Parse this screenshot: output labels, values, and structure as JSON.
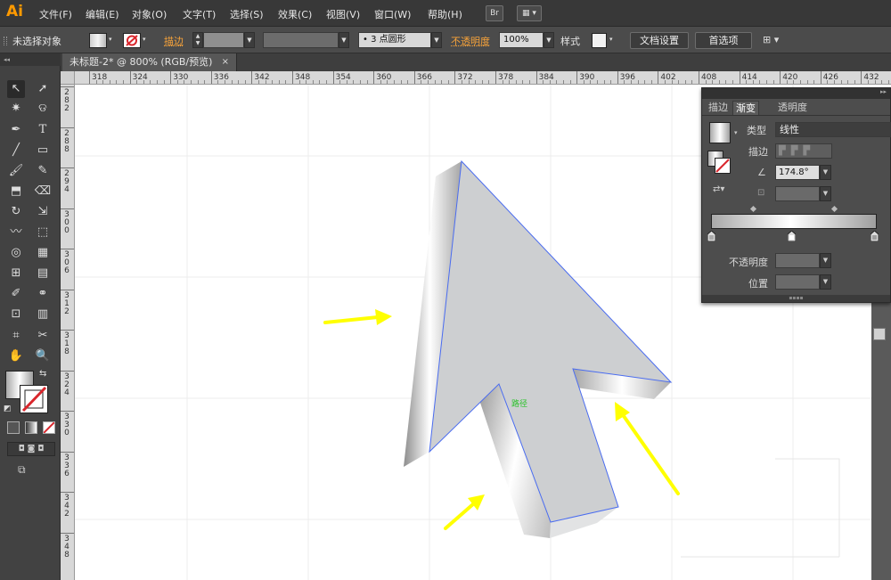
{
  "app": {
    "logo": "Ai",
    "accent_color": "#ff9a00"
  },
  "menu": {
    "items": [
      "文件(F)",
      "编辑(E)",
      "对象(O)",
      "文字(T)",
      "选择(S)",
      "效果(C)",
      "视图(V)",
      "窗口(W)",
      "帮助(H)"
    ],
    "bridge_label": "Br"
  },
  "control_bar": {
    "selection_status": "未选择对象",
    "stroke_label": "描边",
    "brush_value": "3 点圆形",
    "opacity_label": "不透明度",
    "opacity_value": "100%",
    "style_label": "样式",
    "doc_setup_button": "文档设置",
    "preferences_button": "首选项"
  },
  "document": {
    "tab_title": "未标题-2* @ 800% (RGB/预览)",
    "close_glyph": "×"
  },
  "ruler": {
    "top_labels": [
      "318",
      "324",
      "330",
      "336",
      "342",
      "348",
      "354",
      "360",
      "366",
      "372",
      "378",
      "384",
      "390",
      "396",
      "402",
      "408",
      "414",
      "420",
      "426",
      "432"
    ],
    "left_labels": [
      "282",
      "288",
      "294",
      "300",
      "306",
      "312",
      "318",
      "324",
      "330",
      "336",
      "342",
      "348"
    ]
  },
  "canvas": {
    "path_hint": "路径"
  },
  "gradient_panel": {
    "tabs": [
      "描边",
      "渐变",
      "透明度"
    ],
    "active_tab": "渐变",
    "type_label": "类型",
    "type_value": "线性",
    "stroke_label": "描边",
    "angle_value": "174.8°",
    "opacity_label": "不透明度",
    "position_label": "位置",
    "gradient_stops": [
      {
        "color": "#a9a9a9",
        "position": 0
      },
      {
        "color": "#ffffff",
        "position": 48
      },
      {
        "color": "#9e9e9e",
        "position": 100
      }
    ]
  },
  "colors": {
    "arrow_face": "#cdcfd1",
    "selection_outline": "#4a6cf0",
    "annotation_arrow": "#ffff00"
  }
}
